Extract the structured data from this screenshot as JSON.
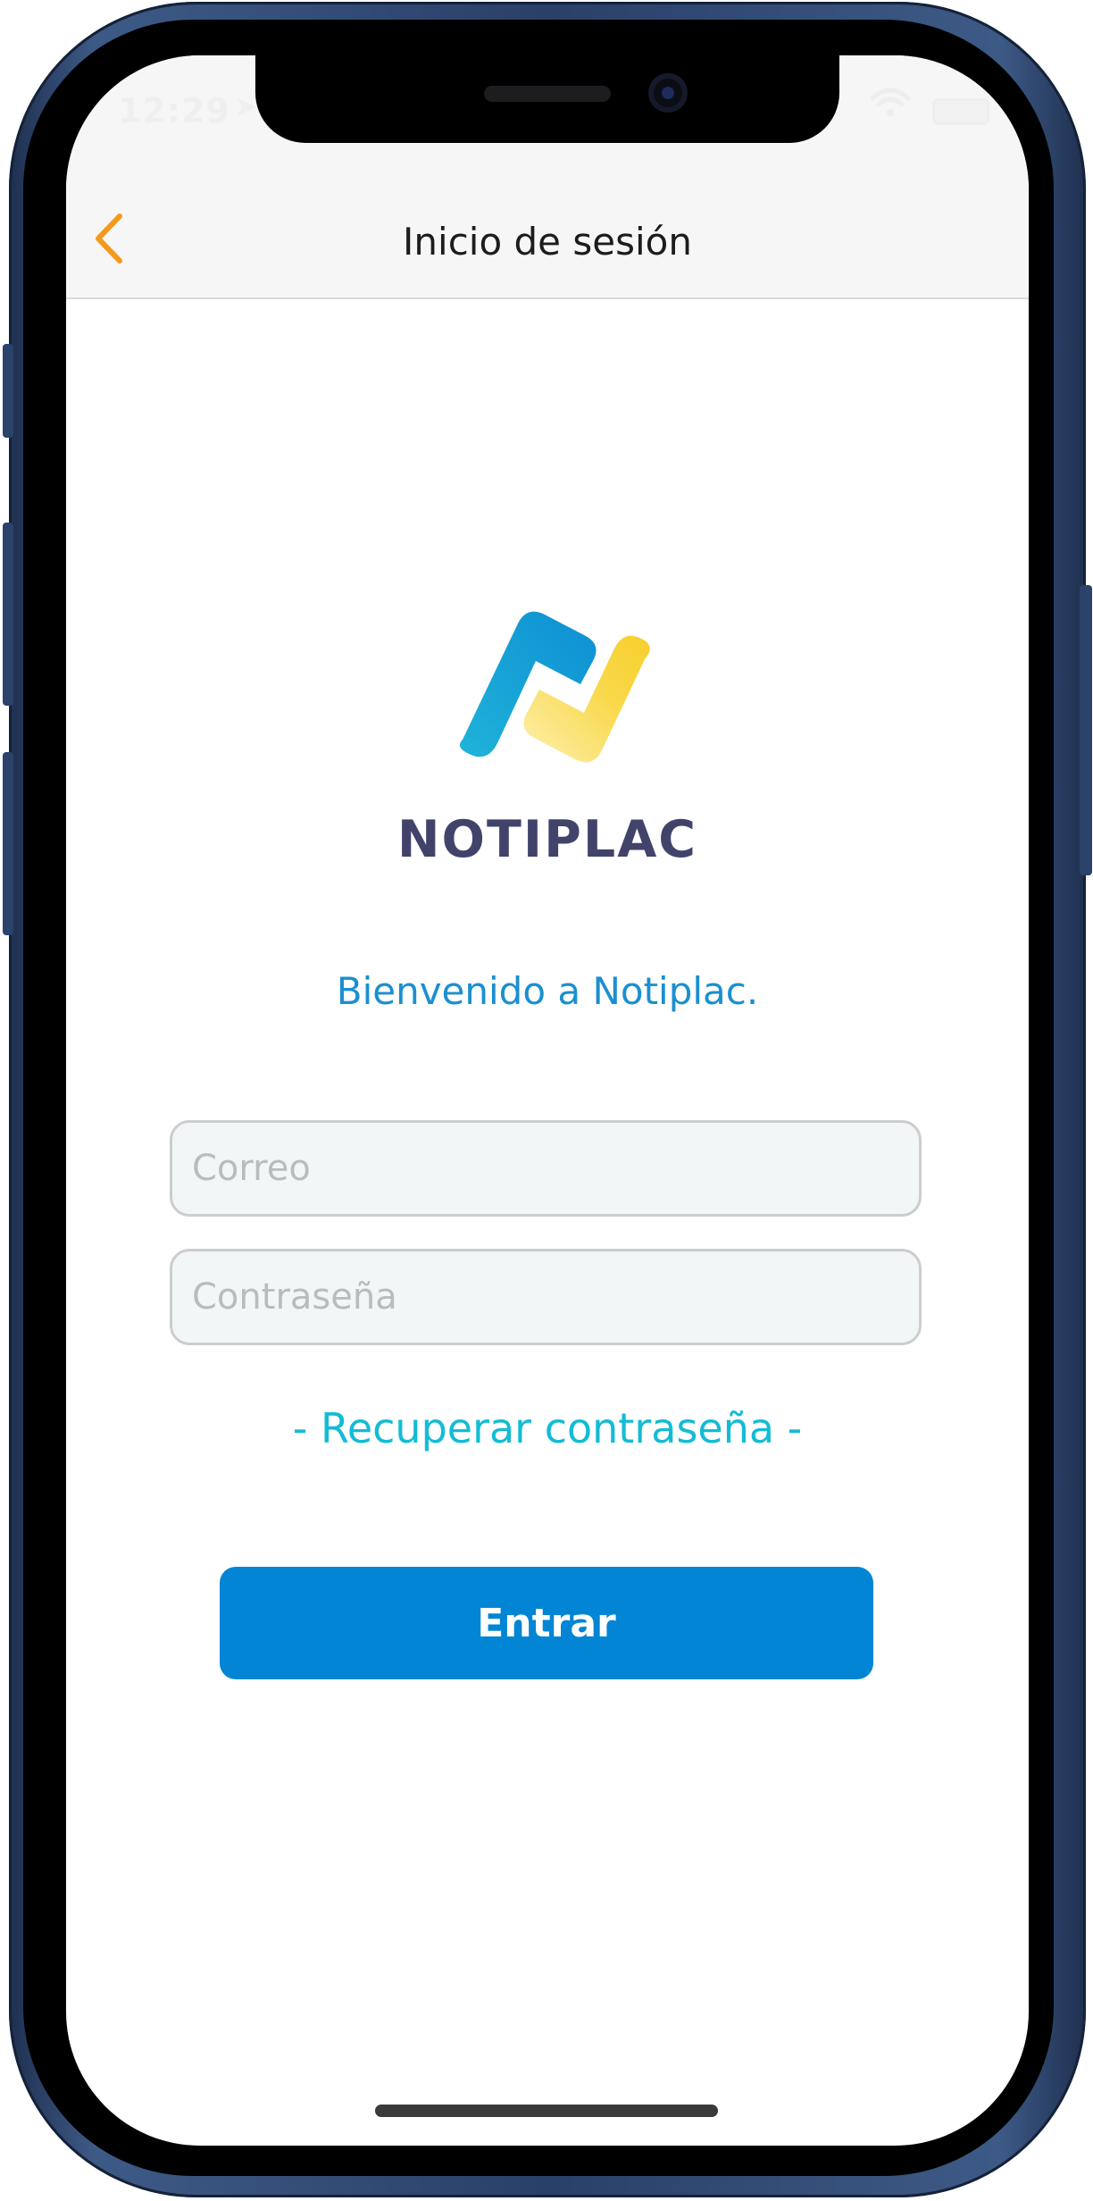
{
  "status_bar": {
    "time": "12:29",
    "location_icon": "location-arrow-icon",
    "wifi_icon": "wifi-icon",
    "battery_icon": "battery-icon"
  },
  "nav_bar": {
    "title": "Inicio de sesión",
    "back_icon": "chevron-left-icon",
    "back_color": "#f39a1e"
  },
  "brand": {
    "name": "NOTIPLAC",
    "logo_colors": {
      "blue": "#19a7dc",
      "yellow": "#f8d23c"
    }
  },
  "login": {
    "welcome": "Bienvenido a Notiplac.",
    "email_placeholder": "Correo",
    "email_value": "",
    "password_placeholder": "Contraseña",
    "password_value": "",
    "recover_link": "- Recuperar contraseña -",
    "submit_label": "Entrar"
  },
  "colors": {
    "primary_button": "#0285d4",
    "link": "#12bcd6",
    "welcome": "#1b8fd0",
    "brand_text": "#41436a"
  }
}
